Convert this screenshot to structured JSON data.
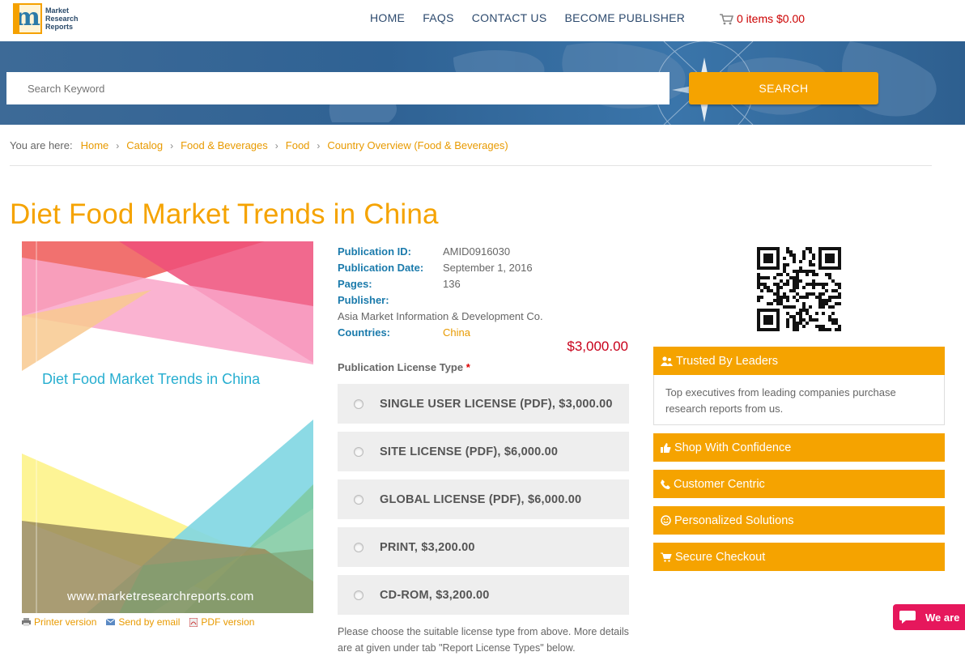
{
  "header": {
    "logo_text": [
      "Market",
      "Research",
      "Reports"
    ],
    "logo_letter": "m",
    "nav": [
      "HOME",
      "FAQS",
      "CONTACT US",
      "BECOME PUBLISHER"
    ],
    "cart": "0 items $0.00"
  },
  "search": {
    "placeholder": "Search Keyword",
    "button": "SEARCH"
  },
  "breadcrumb": {
    "label": "You are here:",
    "items": [
      "Home",
      "Catalog",
      "Food & Beverages",
      "Food",
      "Country Overview (Food & Beverages)"
    ]
  },
  "title": "Diet Food Market Trends in China",
  "cover": {
    "title": "Diet Food Market Trends in China",
    "url": "www.marketresearchreports.com"
  },
  "share": [
    "Printer version",
    "Send by email",
    "PDF version"
  ],
  "details": {
    "publication_id_label": "Publication ID:",
    "publication_id": "AMID0916030",
    "publication_date_label": "Publication Date:",
    "publication_date": "September 1, 2016",
    "pages_label": "Pages:",
    "pages": "136",
    "publisher_label": "Publisher:",
    "publisher": "Asia Market Information & Development Co.",
    "countries_label": "Countries:",
    "countries": "China"
  },
  "price": "$3,000.00",
  "license": {
    "title": "Publication License Type",
    "required_mark": "*",
    "options": [
      "SINGLE USER LICENSE (PDF), $3,000.00",
      "SITE LICENSE (PDF), $6,000.00",
      "GLOBAL LICENSE (PDF), $6,000.00",
      "PRINT, $3,200.00",
      "CD-ROM, $3,200.00"
    ],
    "note": "Please choose the suitable license type from above. More details are at given under tab \"Report License Types\" below."
  },
  "sidebar": {
    "trusted_title": "Trusted By Leaders",
    "trusted_body": "Top executives from leading companies purchase research reports from us.",
    "boxes": [
      "Shop With Confidence",
      "Customer Centric",
      "Personalized Solutions",
      "Secure Checkout"
    ]
  },
  "chat": {
    "label": "We are"
  },
  "colors": {
    "accent": "#f5a300",
    "link": "#e89a00",
    "label_blue": "#1a7aab",
    "price_red": "#c8001a",
    "nav_text": "#2d4a6e",
    "chat_pink": "#e6175c"
  }
}
